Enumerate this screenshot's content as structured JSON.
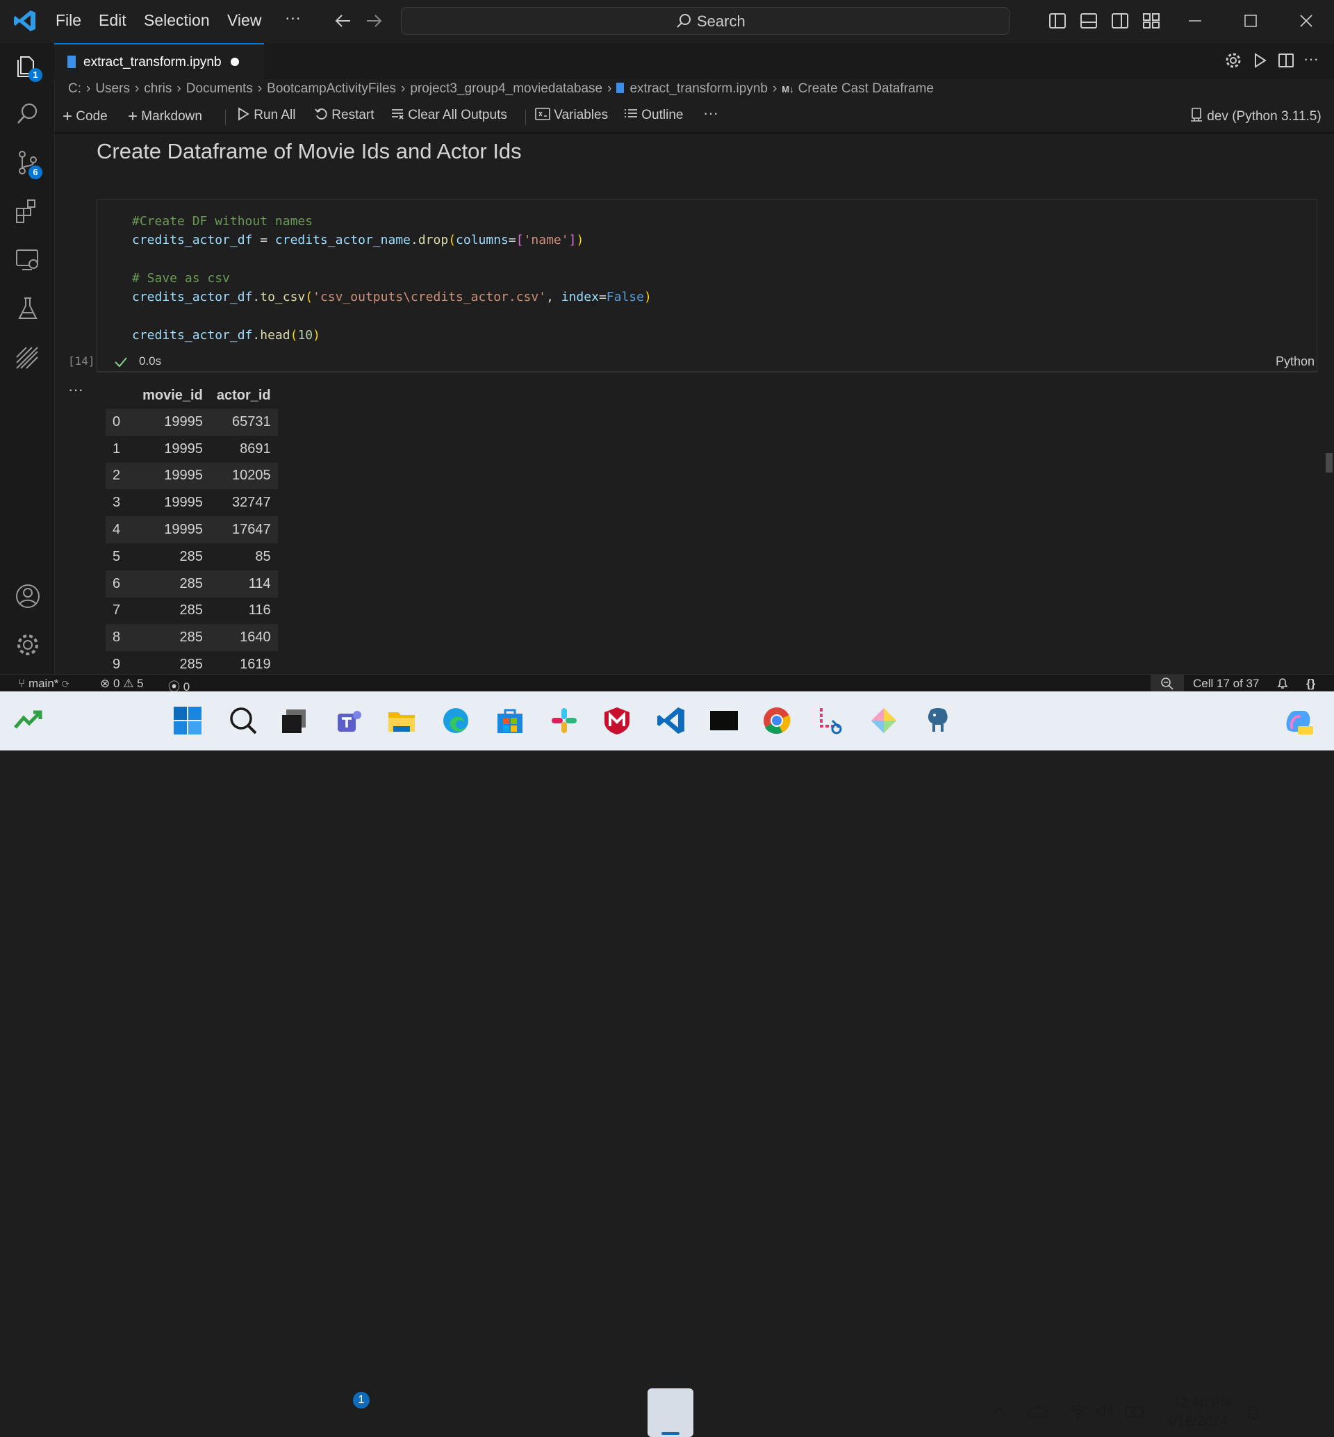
{
  "menu": [
    "File",
    "Edit",
    "Selection",
    "View",
    "···"
  ],
  "search": {
    "label": "Search"
  },
  "activity_badges": {
    "explorer": "1",
    "source_control": "6"
  },
  "tab": {
    "filename": "extract_transform.ipynb"
  },
  "breadcrumb": [
    "C:",
    "Users",
    "chris",
    "Documents",
    "BootcampActivityFiles",
    "project3_group4_moviedatabase",
    "extract_transform.ipynb",
    "Create Cast Dataframe"
  ],
  "toolbar": {
    "code": "Code",
    "markdown": "Markdown",
    "run_all": "Run All",
    "restart": "Restart",
    "clear_outputs": "Clear All Outputs",
    "variables": "Variables",
    "outline": "Outline",
    "more": "···",
    "kernel": "dev (Python 3.11.5)"
  },
  "markdown_cell": {
    "heading": "Create Dataframe of Movie Ids and Actor Ids"
  },
  "code_cell": {
    "lines": [
      "#Create DF without names",
      "credits_actor_df = credits_actor_name.drop(columns=['name'])",
      "",
      "# Save as csv",
      "credits_actor_df.to_csv('csv_outputs\\credits_actor.csv', index=False)",
      "",
      "credits_actor_df.head(10)"
    ],
    "execution_count": "[14]",
    "exec_time": "0.0s",
    "language": "Python"
  },
  "output": {
    "dots": "···",
    "columns": [
      "movie_id",
      "actor_id"
    ],
    "rows": [
      [
        "0",
        "19995",
        "65731"
      ],
      [
        "1",
        "19995",
        "8691"
      ],
      [
        "2",
        "19995",
        "10205"
      ],
      [
        "3",
        "19995",
        "32747"
      ],
      [
        "4",
        "19995",
        "17647"
      ],
      [
        "5",
        "285",
        "85"
      ],
      [
        "6",
        "285",
        "114"
      ],
      [
        "7",
        "285",
        "116"
      ],
      [
        "8",
        "285",
        "1640"
      ],
      [
        "9",
        "285",
        "1619"
      ]
    ]
  },
  "statusbar": {
    "branch": "main*",
    "errors": "0",
    "warnings": "5",
    "ports": "0",
    "cell": "Cell 17 of 37"
  },
  "taskbar": {
    "teams_badge": "1",
    "time": "12:40 PM",
    "date": "4/16/2024"
  },
  "colors": {
    "accent": "#0078d4",
    "background": "#1e1e1e",
    "comment": "#6a9955",
    "string": "#ce9178",
    "keyword": "#569cd6"
  }
}
